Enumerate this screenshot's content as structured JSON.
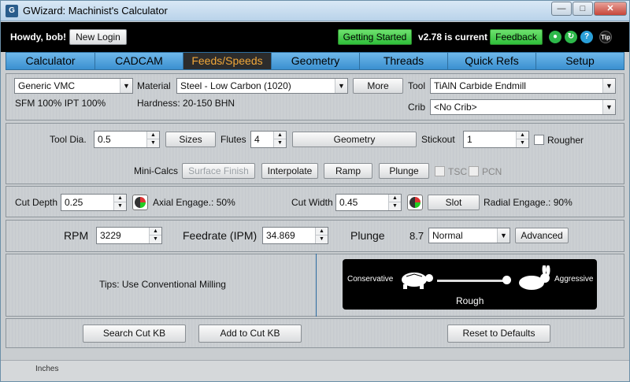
{
  "window": {
    "title": "GWizard: Machinist's Calculator",
    "app_icon": "G"
  },
  "header": {
    "greeting": "Howdy, bob!",
    "new_login": "New Login",
    "getting_started": "Getting Started",
    "version": "v2.78 is current",
    "feedback": "Feedback",
    "tip_icon": "Tip"
  },
  "tabs": [
    "Calculator",
    "CADCAM",
    "Feeds/Speeds",
    "Geometry",
    "Threads",
    "Quick Refs",
    "Setup"
  ],
  "active_tab": "Feeds/Speeds",
  "machine": {
    "value": "Generic VMC",
    "sfm_ipt": "SFM 100%  IPT 100%"
  },
  "material": {
    "label": "Material",
    "value": "Steel - Low Carbon (1020)",
    "more": "More",
    "hardness": "Hardness: 20-150 BHN"
  },
  "tool": {
    "label": "Tool",
    "value": "TiAlN Carbide Endmill",
    "crib_label": "Crib",
    "crib_value": "<No Crib>"
  },
  "tool_params": {
    "dia_label": "Tool Dia.",
    "dia": "0.5",
    "sizes": "Sizes",
    "flutes_label": "Flutes",
    "flutes": "4",
    "geometry": "Geometry",
    "stickout_label": "Stickout",
    "stickout": "1",
    "rougher": "Rougher"
  },
  "minicalcs": {
    "label": "Mini-Calcs",
    "surface_finish": "Surface Finish",
    "interpolate": "Interpolate",
    "ramp": "Ramp",
    "plunge": "Plunge",
    "tsc": "TSC",
    "pcn": "PCN"
  },
  "cut": {
    "depth_label": "Cut Depth",
    "depth": "0.25",
    "axial": "Axial Engage.: 50%",
    "width_label": "Cut Width",
    "width": "0.45",
    "slot": "Slot",
    "radial": "Radial Engage.: 90%"
  },
  "results": {
    "rpm_label": "RPM",
    "rpm": "3229",
    "feed_label": "Feedrate (IPM)",
    "feed": "34.869",
    "plunge_label": "Plunge",
    "plunge": "8.7",
    "plunge_mode": "Normal",
    "advanced": "Advanced"
  },
  "tips": "Tips:  Use Conventional Milling",
  "tradeoff": {
    "left": "Conservative",
    "right": "Aggressive",
    "value_label": "Rough",
    "position": 1.0
  },
  "footer": {
    "search": "Search Cut KB",
    "add": "Add to Cut KB",
    "reset": "Reset to Defaults"
  },
  "status": {
    "units": "Inches"
  },
  "colors": {
    "tab_bar": "#4aa3df",
    "active_tab_text": "#f2a83a",
    "green_button": "#3ccf45",
    "divider": "#2b6aa0"
  }
}
